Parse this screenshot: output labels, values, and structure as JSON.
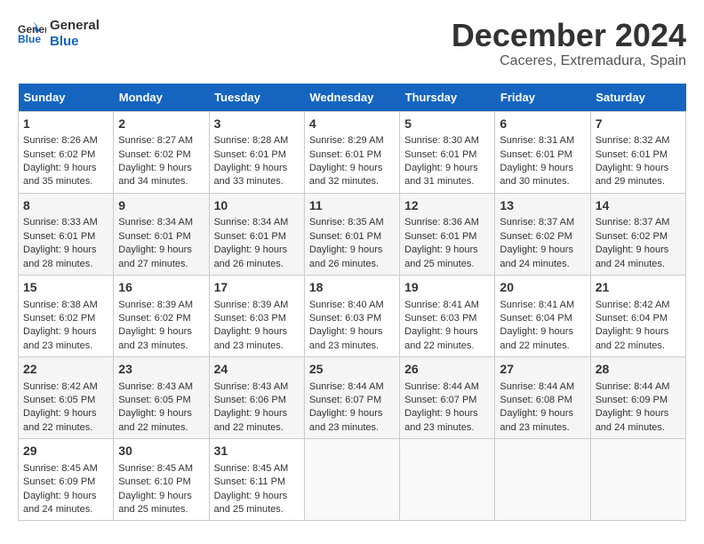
{
  "header": {
    "logo_line1": "General",
    "logo_line2": "Blue",
    "title": "December 2024",
    "subtitle": "Caceres, Extremadura, Spain"
  },
  "weekdays": [
    "Sunday",
    "Monday",
    "Tuesday",
    "Wednesday",
    "Thursday",
    "Friday",
    "Saturday"
  ],
  "weeks": [
    [
      {
        "day": "1",
        "rise": "8:26 AM",
        "set": "6:02 PM",
        "hours": "9 hours and 35 minutes."
      },
      {
        "day": "2",
        "rise": "8:27 AM",
        "set": "6:02 PM",
        "hours": "9 hours and 34 minutes."
      },
      {
        "day": "3",
        "rise": "8:28 AM",
        "set": "6:01 PM",
        "hours": "9 hours and 33 minutes."
      },
      {
        "day": "4",
        "rise": "8:29 AM",
        "set": "6:01 PM",
        "hours": "9 hours and 32 minutes."
      },
      {
        "day": "5",
        "rise": "8:30 AM",
        "set": "6:01 PM",
        "hours": "9 hours and 31 minutes."
      },
      {
        "day": "6",
        "rise": "8:31 AM",
        "set": "6:01 PM",
        "hours": "9 hours and 30 minutes."
      },
      {
        "day": "7",
        "rise": "8:32 AM",
        "set": "6:01 PM",
        "hours": "9 hours and 29 minutes."
      }
    ],
    [
      {
        "day": "8",
        "rise": "8:33 AM",
        "set": "6:01 PM",
        "hours": "9 hours and 28 minutes."
      },
      {
        "day": "9",
        "rise": "8:34 AM",
        "set": "6:01 PM",
        "hours": "9 hours and 27 minutes."
      },
      {
        "day": "10",
        "rise": "8:34 AM",
        "set": "6:01 PM",
        "hours": "9 hours and 26 minutes."
      },
      {
        "day": "11",
        "rise": "8:35 AM",
        "set": "6:01 PM",
        "hours": "9 hours and 26 minutes."
      },
      {
        "day": "12",
        "rise": "8:36 AM",
        "set": "6:01 PM",
        "hours": "9 hours and 25 minutes."
      },
      {
        "day": "13",
        "rise": "8:37 AM",
        "set": "6:02 PM",
        "hours": "9 hours and 24 minutes."
      },
      {
        "day": "14",
        "rise": "8:37 AM",
        "set": "6:02 PM",
        "hours": "9 hours and 24 minutes."
      }
    ],
    [
      {
        "day": "15",
        "rise": "8:38 AM",
        "set": "6:02 PM",
        "hours": "9 hours and 23 minutes."
      },
      {
        "day": "16",
        "rise": "8:39 AM",
        "set": "6:02 PM",
        "hours": "9 hours and 23 minutes."
      },
      {
        "day": "17",
        "rise": "8:39 AM",
        "set": "6:03 PM",
        "hours": "9 hours and 23 minutes."
      },
      {
        "day": "18",
        "rise": "8:40 AM",
        "set": "6:03 PM",
        "hours": "9 hours and 23 minutes."
      },
      {
        "day": "19",
        "rise": "8:41 AM",
        "set": "6:03 PM",
        "hours": "9 hours and 22 minutes."
      },
      {
        "day": "20",
        "rise": "8:41 AM",
        "set": "6:04 PM",
        "hours": "9 hours and 22 minutes."
      },
      {
        "day": "21",
        "rise": "8:42 AM",
        "set": "6:04 PM",
        "hours": "9 hours and 22 minutes."
      }
    ],
    [
      {
        "day": "22",
        "rise": "8:42 AM",
        "set": "6:05 PM",
        "hours": "9 hours and 22 minutes."
      },
      {
        "day": "23",
        "rise": "8:43 AM",
        "set": "6:05 PM",
        "hours": "9 hours and 22 minutes."
      },
      {
        "day": "24",
        "rise": "8:43 AM",
        "set": "6:06 PM",
        "hours": "9 hours and 22 minutes."
      },
      {
        "day": "25",
        "rise": "8:44 AM",
        "set": "6:07 PM",
        "hours": "9 hours and 23 minutes."
      },
      {
        "day": "26",
        "rise": "8:44 AM",
        "set": "6:07 PM",
        "hours": "9 hours and 23 minutes."
      },
      {
        "day": "27",
        "rise": "8:44 AM",
        "set": "6:08 PM",
        "hours": "9 hours and 23 minutes."
      },
      {
        "day": "28",
        "rise": "8:44 AM",
        "set": "6:09 PM",
        "hours": "9 hours and 24 minutes."
      }
    ],
    [
      {
        "day": "29",
        "rise": "8:45 AM",
        "set": "6:09 PM",
        "hours": "9 hours and 24 minutes."
      },
      {
        "day": "30",
        "rise": "8:45 AM",
        "set": "6:10 PM",
        "hours": "9 hours and 25 minutes."
      },
      {
        "day": "31",
        "rise": "8:45 AM",
        "set": "6:11 PM",
        "hours": "9 hours and 25 minutes."
      },
      null,
      null,
      null,
      null
    ]
  ],
  "labels": {
    "sunrise": "Sunrise:",
    "sunset": "Sunset:",
    "daylight": "Daylight:"
  }
}
